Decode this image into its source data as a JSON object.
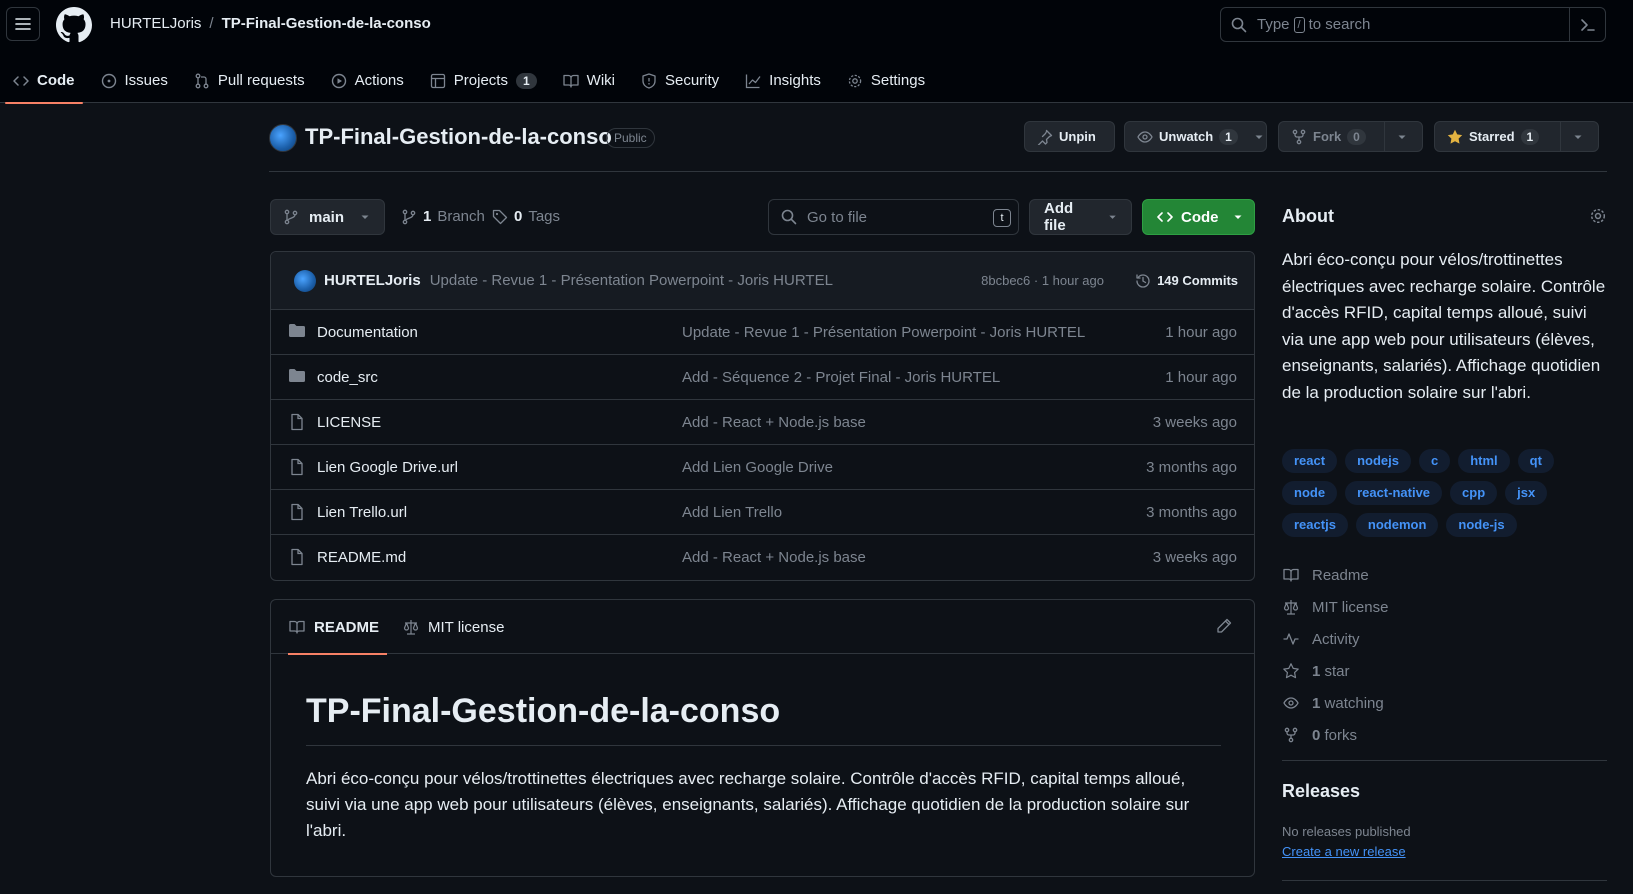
{
  "header": {
    "owner": "HURTELJoris",
    "separator": "/",
    "repo": "TP-Final-Gestion-de-la-conso",
    "search_prefix": "Type",
    "search_key": "/",
    "search_suffix": "to search"
  },
  "tabs": [
    {
      "label": "Code",
      "icon": "code-icon"
    },
    {
      "label": "Issues",
      "icon": "issue-icon"
    },
    {
      "label": "Pull requests",
      "icon": "pull-request-icon"
    },
    {
      "label": "Actions",
      "icon": "play-icon"
    },
    {
      "label": "Projects",
      "icon": "table-icon",
      "count": "1"
    },
    {
      "label": "Wiki",
      "icon": "book-icon"
    },
    {
      "label": "Security",
      "icon": "shield-icon"
    },
    {
      "label": "Insights",
      "icon": "graph-icon"
    },
    {
      "label": "Settings",
      "icon": "gear-icon"
    }
  ],
  "repo_header": {
    "title": "TP-Final-Gestion-de-la-conso",
    "visibility": "Public",
    "unpin": "Unpin",
    "unwatch": "Unwatch",
    "watch_count": "1",
    "fork": "Fork",
    "fork_count": "0",
    "starred": "Starred",
    "star_count": "1"
  },
  "toolbar": {
    "branch": "main",
    "branch_count": "1",
    "branch_label": "Branch",
    "tag_count": "0",
    "tag_label": "Tags",
    "goto_placeholder": "Go to file",
    "goto_key": "t",
    "add_file": "Add file",
    "code": "Code"
  },
  "commit": {
    "author": "HURTELJoris",
    "message": "Update - Revue 1 - Présentation Powerpoint - Joris HURTEL",
    "meta": "8bcbec6 · 1 hour ago",
    "commits": "149 Commits"
  },
  "files": [
    {
      "name": "Documentation",
      "type": "folder",
      "message": "Update - Revue 1 - Présentation Powerpoint - Joris HURTEL",
      "date": "1 hour ago"
    },
    {
      "name": "code_src",
      "type": "folder",
      "message": "Add - Séquence 2 - Projet Final - Joris HURTEL",
      "date": "1 hour ago"
    },
    {
      "name": "LICENSE",
      "type": "file",
      "message": "Add - React + Node.js base",
      "date": "3 weeks ago"
    },
    {
      "name": "Lien Google Drive.url",
      "type": "file",
      "message": "Add Lien Google Drive",
      "date": "3 months ago"
    },
    {
      "name": "Lien Trello.url",
      "type": "file",
      "message": "Add Lien Trello",
      "date": "3 months ago"
    },
    {
      "name": "README.md",
      "type": "file",
      "message": "Add - React + Node.js base",
      "date": "3 weeks ago"
    }
  ],
  "readme": {
    "tab_readme": "README",
    "tab_license": "MIT license",
    "title": "TP-Final-Gestion-de-la-conso",
    "body": "Abri éco-conçu pour vélos/trottinettes électriques avec recharge solaire. Contrôle d'accès RFID, capital temps alloué, suivi via une app web pour utilisateurs (élèves, enseignants, salariés). Affichage quotidien de la production solaire sur l'abri."
  },
  "about": {
    "heading": "About",
    "description": "Abri éco-conçu pour vélos/trottinettes électriques avec recharge solaire. Contrôle d'accès RFID, capital temps alloué, suivi via une app web pour utilisateurs (élèves, enseignants, salariés). Affichage quotidien de la production solaire sur l'abri.",
    "topics": [
      "react",
      "nodejs",
      "c",
      "html",
      "qt",
      "node",
      "react-native",
      "cpp",
      "jsx",
      "reactjs",
      "nodemon",
      "node-js"
    ],
    "readme": "Readme",
    "license": "MIT license",
    "activity": "Activity",
    "stars_count": "1",
    "stars_label": "star",
    "watching_count": "1",
    "watching_label": "watching",
    "forks_count": "0",
    "forks_label": "forks"
  },
  "releases": {
    "heading": "Releases",
    "none": "No releases published",
    "create": "Create a new release"
  }
}
